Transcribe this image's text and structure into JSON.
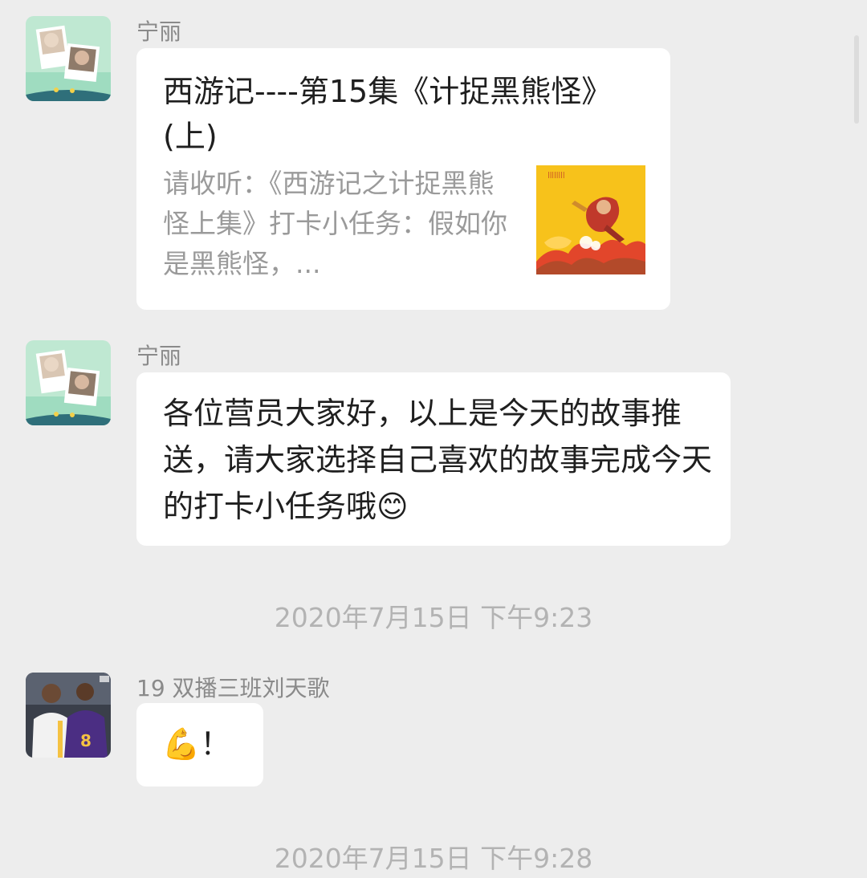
{
  "messages": [
    {
      "sender": "宁丽",
      "card": {
        "title": "西游记----第15集《计捉黑熊怪》(上)",
        "description": "请收听：《西游记之计捉黑熊怪上集》打卡小任务：假如你是黑熊怪，...",
        "thumbnail_icon": "monkey-king-cartoon-thumbnail"
      }
    },
    {
      "sender": "宁丽",
      "text": "各位营员大家好，以上是今天的故事推送，请大家选择自己喜欢的故事完成今天的打卡小任务哦",
      "emoji": "😊"
    },
    {
      "sender": "19 双播三班刘天歌",
      "text": "！",
      "emoji": "💪"
    }
  ],
  "timestamps": [
    "2020年7月15日 下午9:23",
    "2020年7月15日 下午9:28"
  ],
  "colors": {
    "background": "#ededed",
    "bubble": "#ffffff",
    "sender_text": "#8a8a8a",
    "timestamp_text": "#b3b3b3"
  }
}
